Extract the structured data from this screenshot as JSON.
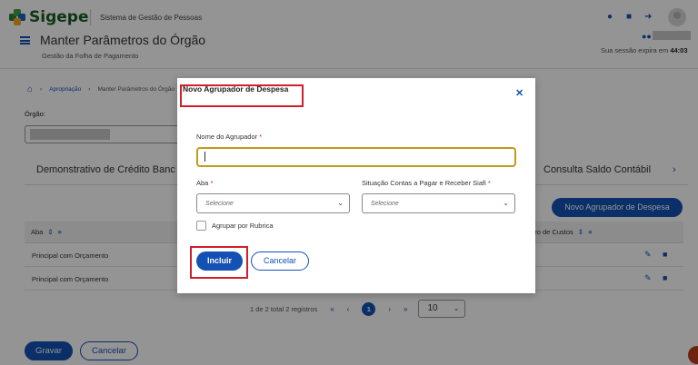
{
  "header": {
    "brand": "Sigepe",
    "system_name": "Sistema de Gestão de Pessoas",
    "page_title": "Manter Parâmetros do Órgão",
    "page_subtitle": "Gestão da Folha de Pagamento",
    "session_label": "Sua sessão expira em",
    "session_time": "44:03"
  },
  "breadcrumb": {
    "items": [
      "Apropriação",
      "Manter Parâmetros do Órgão"
    ]
  },
  "form": {
    "orgao_label": "Órgão:"
  },
  "tabs": {
    "left": "Demonstrativo de Crédito Banc",
    "right": "Consulta Saldo Contábil"
  },
  "buttons": {
    "new_group": "Novo Agrupador de Despesa",
    "save": "Gravar",
    "cancel": "Cancelar"
  },
  "table": {
    "headers": [
      "Aba",
      "ntro de Custos"
    ],
    "rows": [
      "Principal com Orçamento",
      "Principal com Orçamento"
    ]
  },
  "pagination": {
    "summary": "1 de 2 total 2 registros",
    "current_page": "1",
    "page_size": "10"
  },
  "modal": {
    "title": "Novo Agrupador de Despesa",
    "name_label": "Nome do Agrupador",
    "name_value": "",
    "aba_label": "Aba",
    "aba_placeholder": "Selecione",
    "situacao_label": "Situação Contas a Pagar e Receber Siafi",
    "situacao_placeholder": "Selecione",
    "checkbox_label": "Agrupar por Rubrica",
    "checkbox_checked": false,
    "include_label": "Incluir",
    "cancel_label": "Cancelar",
    "required_mark": "*"
  },
  "colors": {
    "primary": "#1351b4",
    "brand_green": "#1b5e20",
    "highlight_red": "#d0202a",
    "focus_border": "#c39a1a"
  }
}
